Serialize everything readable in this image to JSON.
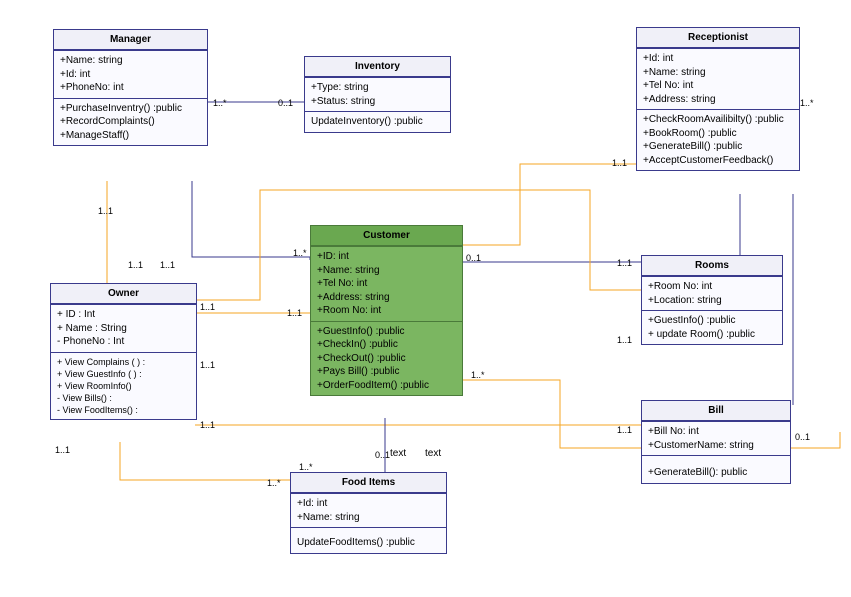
{
  "classes": {
    "manager": {
      "name": "Manager",
      "attrs": [
        "+Name: string",
        "+Id: int",
        "+PhoneNo: int"
      ],
      "ops": [
        "+PurchaseInventry() :public",
        "+RecordComplaints()",
        "+ManageStaff()"
      ]
    },
    "inventory": {
      "name": "Inventory",
      "attrs": [
        "+Type: string",
        "+Status: string"
      ],
      "ops": [
        "UpdateInventory() :public"
      ]
    },
    "receptionist": {
      "name": "Receptionist",
      "attrs": [
        "+Id: int",
        "+Name: string",
        "+Tel No: int",
        "+Address: string"
      ],
      "ops": [
        "+CheckRoomAvailibilty() :public",
        "+BookRoom() :public",
        "+GenerateBill() :public",
        "+AcceptCustomerFeedback()"
      ]
    },
    "owner": {
      "name": "Owner",
      "attrs": [
        "+ ID : Int",
        "+ Name : String",
        "- PhoneNo : Int"
      ],
      "ops": [
        "+ View Complains ( ) :",
        "+ View GuestInfo ( ) :",
        "+ View RoomInfo()",
        "- View Bills() :",
        "- View FoodItems() :"
      ]
    },
    "customer": {
      "name": "Customer",
      "attrs": [
        "+ID: int",
        "+Name: string",
        "+Tel No: int",
        "+Address: string",
        "+Room No: int"
      ],
      "ops": [
        "+GuestInfo() :public",
        "+CheckIn() :public",
        "+CheckOut() :public",
        "+Pays Bill() :public",
        "+OrderFoodItem() :public"
      ]
    },
    "rooms": {
      "name": "Rooms",
      "attrs": [
        "+Room No: int",
        "+Location: string"
      ],
      "ops": [
        "+GuestInfo() :public",
        "+ update Room() :public"
      ]
    },
    "bill": {
      "name": "Bill",
      "attrs": [
        "+Bill No: int",
        "+CustomerName: string"
      ],
      "ops": [
        "+GenerateBill(): public"
      ]
    },
    "fooditems": {
      "name": "Food Items",
      "attrs": [
        "+Id: int",
        "+Name: string"
      ],
      "ops": [
        "UpdateFoodItems() :public"
      ]
    }
  },
  "mult": {
    "m_inv_left": "1..*",
    "m_inv_right": "0..1",
    "m_cust_top": "1..*",
    "m_recept_left": "1..1",
    "m_recept_right": "1..*",
    "m_own_top_a": "1..1",
    "m_mgr_bot_a": "1..1",
    "m_mgr_bot_b": "1..1",
    "m_own_right_a": "1..1",
    "m_own_right_b": "1..1",
    "m_own_right_c": "1..1",
    "m_own_bot": "1..1",
    "m_cust_left": "1..1",
    "m_cust_right_top": "0..1",
    "m_rooms_left": "1..1",
    "m_rooms_bot": "1..1",
    "m_cust_right_mid": "1..*",
    "m_bill_left": "1..1",
    "m_bill_right": "0..1",
    "m_cust_bot": "0..1",
    "m_food_top": "1..*",
    "m_food_left": "1..*"
  },
  "labels": {
    "text1": "text",
    "text2": "text"
  },
  "chart_data": {
    "type": "table",
    "diagram_type": "UML class diagram",
    "classes": [
      {
        "name": "Manager",
        "attributes": [
          "+Name: string",
          "+Id: int",
          "+PhoneNo: int"
        ],
        "operations": [
          "+PurchaseInventry() :public",
          "+RecordComplaints()",
          "+ManageStaff()"
        ]
      },
      {
        "name": "Inventory",
        "attributes": [
          "+Type: string",
          "+Status: string"
        ],
        "operations": [
          "UpdateInventory() :public"
        ]
      },
      {
        "name": "Receptionist",
        "attributes": [
          "+Id: int",
          "+Name: string",
          "+Tel No: int",
          "+Address: string"
        ],
        "operations": [
          "+CheckRoomAvailibilty() :public",
          "+BookRoom() :public",
          "+GenerateBill() :public",
          "+AcceptCustomerFeedback()"
        ]
      },
      {
        "name": "Owner",
        "attributes": [
          "+ ID : Int",
          "+ Name : String",
          "- PhoneNo : Int"
        ],
        "operations": [
          "+ View Complains ( ) :",
          "+ View GuestInfo ( ) :",
          "+ View RoomInfo()",
          "- View Bills() :",
          "- View FoodItems() :"
        ]
      },
      {
        "name": "Customer",
        "attributes": [
          "+ID: int",
          "+Name: string",
          "+Tel No: int",
          "+Address: string",
          "+Room No: int"
        ],
        "operations": [
          "+GuestInfo() :public",
          "+CheckIn() :public",
          "+CheckOut() :public",
          "+Pays Bill() :public",
          "+OrderFoodItem() :public"
        ]
      },
      {
        "name": "Rooms",
        "attributes": [
          "+Room No: int",
          "+Location: string"
        ],
        "operations": [
          "+GuestInfo() :public",
          "+ update Room() :public"
        ]
      },
      {
        "name": "Bill",
        "attributes": [
          "+Bill No: int",
          "+CustomerName: string"
        ],
        "operations": [
          "+GenerateBill(): public"
        ]
      },
      {
        "name": "Food Items",
        "attributes": [
          "+Id: int",
          "+Name: string"
        ],
        "operations": [
          "UpdateFoodItems() :public"
        ]
      }
    ],
    "associations": [
      {
        "from": "Manager",
        "to": "Inventory",
        "from_mult": "1..*",
        "to_mult": "0..1"
      },
      {
        "from": "Manager",
        "to": "Customer",
        "from_mult": "1",
        "to_mult": "1..*"
      },
      {
        "from": "Owner",
        "to": "Manager",
        "from_mult": "1..1",
        "to_mult": "1..1"
      },
      {
        "from": "Owner",
        "to": "Customer",
        "from_mult": "1..1",
        "to_mult": "1..1"
      },
      {
        "from": "Owner",
        "to": "Rooms",
        "from_mult": "1..1",
        "to_mult": "1..1"
      },
      {
        "from": "Owner",
        "to": "Bill",
        "from_mult": "1..1",
        "to_mult": "1..1"
      },
      {
        "from": "Owner",
        "to": "Food Items",
        "from_mult": "1..1",
        "to_mult": "1..*"
      },
      {
        "from": "Customer",
        "to": "Receptionist",
        "from_mult": "1..*",
        "to_mult": "1..1"
      },
      {
        "from": "Customer",
        "to": "Rooms",
        "from_mult": "0..1",
        "to_mult": "1..1"
      },
      {
        "from": "Customer",
        "to": "Bill",
        "from_mult": "1..*",
        "to_mult": "0..1",
        "label": "text"
      },
      {
        "from": "Customer",
        "to": "Food Items",
        "from_mult": "0..1",
        "to_mult": "1..*",
        "label": "text"
      },
      {
        "from": "Receptionist",
        "to": "Rooms",
        "from_mult": "1..*",
        "to_mult": ""
      },
      {
        "from": "Receptionist",
        "to": "Bill",
        "from_mult": "",
        "to_mult": ""
      }
    ]
  }
}
